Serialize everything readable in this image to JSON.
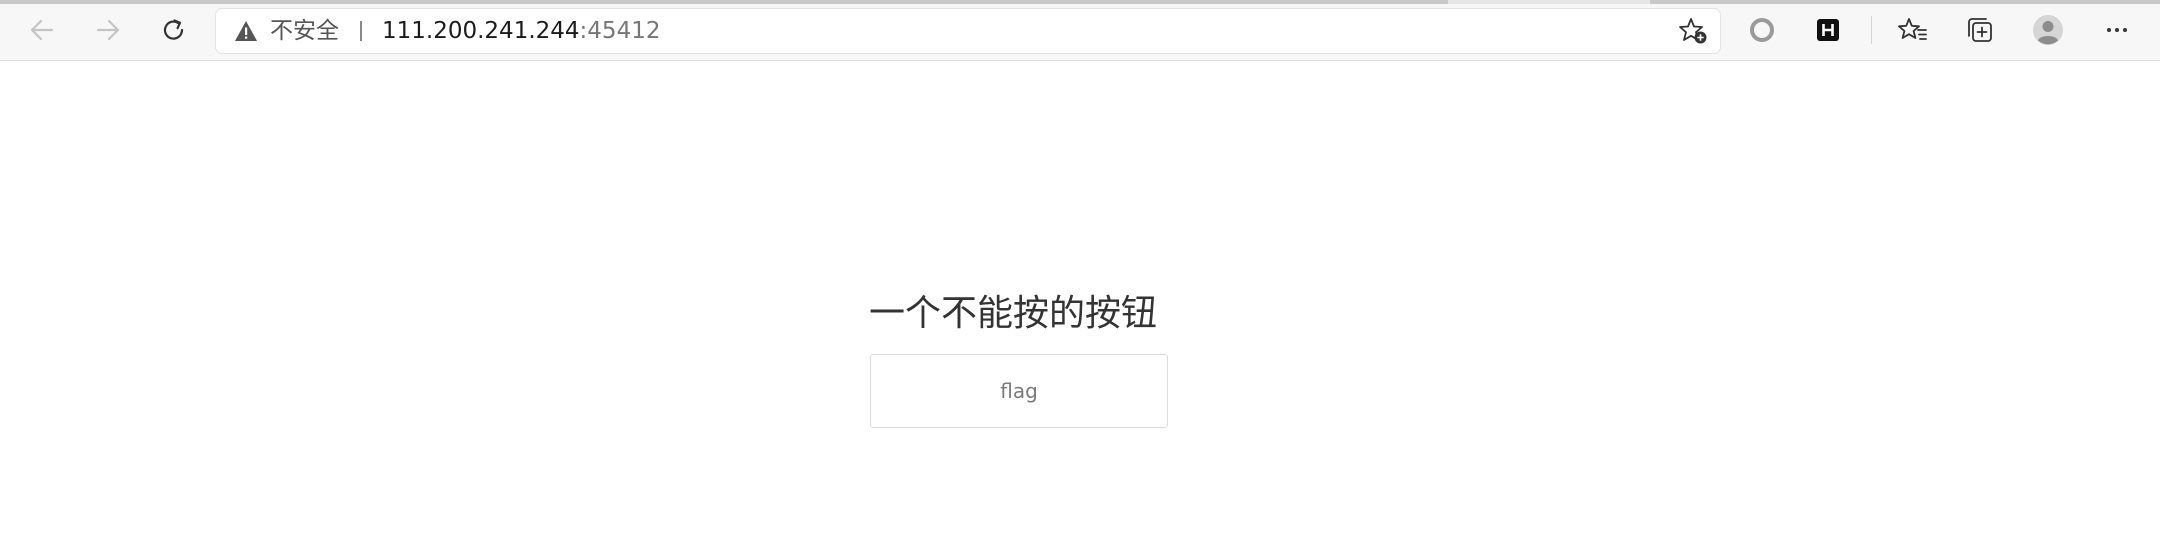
{
  "browser": {
    "insecure_label": "不安全",
    "url_host": "111.200.241.244",
    "url_port": ":45412",
    "icons": {
      "back": "arrow-left-icon",
      "forward": "arrow-right-icon",
      "refresh": "refresh-icon",
      "warning": "warning-triangle-icon",
      "favorite": "add-favorite-icon",
      "extension1": "circle-extension-icon",
      "extension2": "h-extension-icon",
      "favorites": "favorites-list-icon",
      "collections": "collections-icon",
      "profile": "profile-avatar-icon",
      "menu": "more-menu-icon"
    }
  },
  "page": {
    "heading": "一个不能按的按钮",
    "button_label": "flag"
  }
}
